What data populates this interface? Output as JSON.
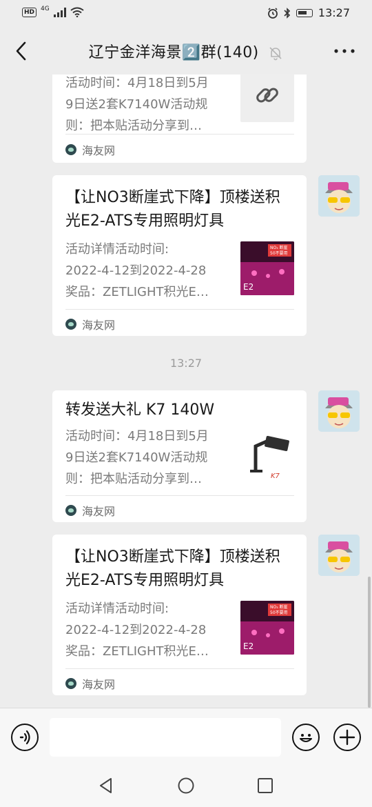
{
  "status_bar": {
    "left_badges": [
      "HD",
      "4G"
    ],
    "time": "13:27"
  },
  "header": {
    "title": "辽宁金洋海景2️⃣群(140)",
    "icons": [
      "back-arrow-icon",
      "mute-bell-icon",
      "more-icon"
    ]
  },
  "messages": [
    {
      "type": "link-card",
      "title": "",
      "desc_lines": [
        "活动时间：4月18日到5月",
        "9日送2套K7140W活动规",
        "则：把本贴活动分享到…"
      ],
      "source": "海友网",
      "thumb": "link-icon"
    },
    {
      "type": "link-card",
      "title": "【让NO3断崖式下降】顶楼送积光E2-ATS专用照明灯具",
      "desc_lines": [
        "活动详情活动时间:",
        "2022-4-12到2022-4-28",
        "奖品：ZETLIGHT积光E…"
      ],
      "source": "海友网",
      "thumb": "e2-lamp-poster",
      "thumb_text": [
        "NO₃ 断崖",
        "50不要用",
        "E2"
      ]
    },
    {
      "type": "timestamp",
      "text": "13:27"
    },
    {
      "type": "link-card",
      "title": "转发送大礼 K7 140W",
      "desc_lines": [
        "活动时间：4月18日到5月",
        "9日送2套K7140W活动规",
        "则：把本贴活动分享到…"
      ],
      "source": "海友网",
      "thumb": "k7-lamp-photo",
      "thumb_text": [
        "K7"
      ]
    },
    {
      "type": "link-card",
      "title": "【让NO3断崖式下降】顶楼送积光E2-ATS专用照明灯具",
      "desc_lines": [
        "活动详情活动时间:",
        "2022-4-12到2022-4-28",
        "奖品：ZETLIGHT积光E…"
      ],
      "source": "海友网",
      "thumb": "e2-lamp-poster",
      "thumb_text": [
        "NO₃ 断崖",
        "50不要用",
        "E2"
      ]
    }
  ],
  "input_bar": {
    "placeholder": "",
    "icons": [
      "voice-icon",
      "emoji-icon",
      "plus-icon"
    ]
  },
  "nav_bar": {
    "icons": [
      "back-triangle-icon",
      "home-circle-icon",
      "recents-square-icon"
    ]
  },
  "colors": {
    "background": "#ededed",
    "card": "#ffffff",
    "desc_text": "#7a7a7a"
  }
}
